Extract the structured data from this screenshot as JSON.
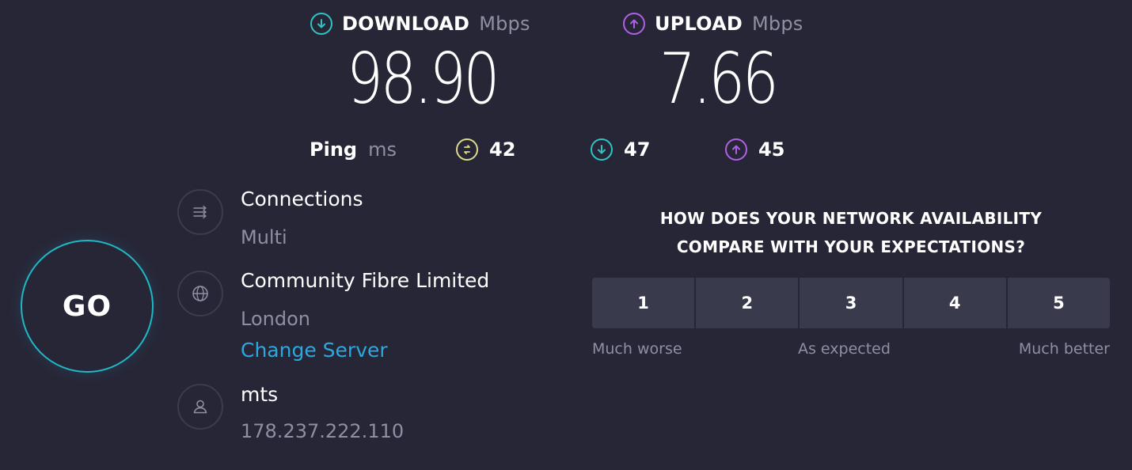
{
  "download": {
    "label": "DOWNLOAD",
    "unit": "Mbps",
    "value": "98.90",
    "icon": "download-arrow-icon",
    "color": "#2fc4c4"
  },
  "upload": {
    "label": "UPLOAD",
    "unit": "Mbps",
    "value": "7.66",
    "icon": "upload-arrow-icon",
    "color": "#b25fe6"
  },
  "ping": {
    "label": "Ping",
    "unit": "ms",
    "idle": {
      "value": "42",
      "icon": "idle-latency-icon",
      "color": "#e0d98a"
    },
    "download": {
      "value": "47",
      "icon": "download-latency-icon",
      "color": "#2fc4c4"
    },
    "upload": {
      "value": "45",
      "icon": "upload-latency-icon",
      "color": "#b25fe6"
    }
  },
  "go_button": {
    "label": "GO",
    "color": "#1fb8c6"
  },
  "connections": {
    "title": "Connections",
    "value": "Multi",
    "icon": "connections-icon"
  },
  "server": {
    "name": "Community Fibre Limited",
    "location": "London",
    "change_label": "Change Server",
    "icon": "globe-icon"
  },
  "provider": {
    "name": "mts",
    "ip": "178.237.222.110",
    "icon": "user-icon"
  },
  "survey": {
    "question_line1": "HOW DOES YOUR NETWORK AVAILABILITY",
    "question_line2": "COMPARE WITH YOUR EXPECTATIONS?",
    "options": [
      "1",
      "2",
      "3",
      "4",
      "5"
    ],
    "low_label": "Much worse",
    "mid_label": "As expected",
    "high_label": "Much better"
  }
}
